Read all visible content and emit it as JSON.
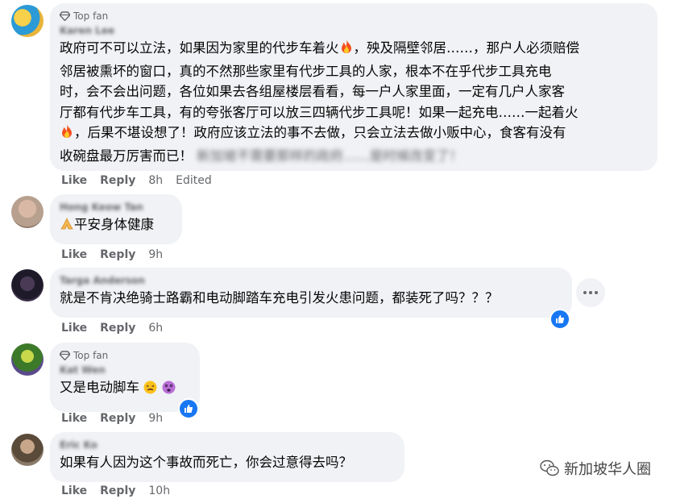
{
  "comments": [
    {
      "badge": "Top fan",
      "author": "Karen Lee",
      "lines": [
        "政府可不可以立法，如果因为家里的代步车着火",
        "，殃及隔壁邻居……，那户人必须赔偿",
        "邻居被熏坏的窗口，真的不然那些家里有代步工具的人家，根本不在乎代步工具充电",
        "时，会不会出问题，各位如果去各组屋楼层看看，每一户人家里面，一定有几户人家客",
        "厅都有代步车工具，有的夸张客厅可以放三四辆代步工具呢！如果一起充电……一起着火",
        "，后果不堪设想了！政府应该立法的事不去做，只会立法去做小贩中心，食客有没有",
        "收碗盘最万厉害而已！",
        "新加坡不需要那样的政府……是时候改变了！"
      ],
      "like": "Like",
      "reply": "Reply",
      "time": "8h",
      "edited": "Edited"
    },
    {
      "author": "Hong Keow Tan",
      "text": "平安身体健康",
      "like": "Like",
      "reply": "Reply",
      "time": "9h"
    },
    {
      "author": "Targa Anderson",
      "text": "就是不肯决绝骑士路霸和电动脚踏车充电引发火患问题，都装死了吗？？？",
      "like": "Like",
      "reply": "Reply",
      "time": "6h"
    },
    {
      "badge": "Top fan",
      "author": "Kat Wen",
      "text": "又是电动脚车",
      "like": "Like",
      "reply": "Reply",
      "time": "9h"
    },
    {
      "author": "Eric Ko",
      "text": "如果有人因为这个事故而死亡，你会过意得去吗？",
      "like": "Like",
      "reply": "Reply",
      "time": "10h"
    }
  ],
  "watermark": "新加坡华人圈",
  "colors": {
    "bubble": "#f0f2f5",
    "meta": "#65676b",
    "like_blue": "#1877f2"
  }
}
